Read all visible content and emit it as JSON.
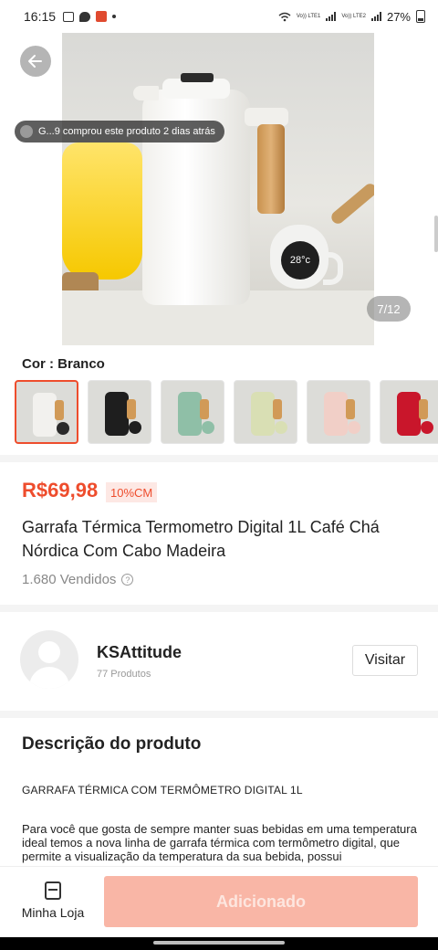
{
  "status_bar": {
    "time": "16:15",
    "network_1": "Vo)) LTE1",
    "network_2": "Vo)) LTE2",
    "battery": "27%"
  },
  "hero": {
    "purchase_notice": "G...9 comprou este produto 2 dias atrás",
    "image_counter": "7/12",
    "cup_display": "28°c"
  },
  "color": {
    "label": "Cor : Branco",
    "options": [
      {
        "name": "branco",
        "body": "#f2f1ee",
        "accent": "#2a2a2a"
      },
      {
        "name": "preto",
        "body": "#1e1e1e",
        "accent": "#1e1e1e"
      },
      {
        "name": "verde",
        "body": "#8fbfa7",
        "accent": "#8fbfa7"
      },
      {
        "name": "creme",
        "body": "#d9dfb4",
        "accent": "#d9dfb4"
      },
      {
        "name": "rosa",
        "body": "#f1cfc7",
        "accent": "#f1cfc7"
      },
      {
        "name": "vermelho",
        "body": "#c9162b",
        "accent": "#c9162b"
      }
    ]
  },
  "product": {
    "price": "R$69,98",
    "discount_tag": "10%CM",
    "title": "Garrafa Térmica Termometro Digital 1L Café Chá Nórdica Com Cabo Madeira",
    "sold": "1.680 Vendidos"
  },
  "store": {
    "name": "KSAttitude",
    "products": "77 Produtos",
    "visit_label": "Visitar"
  },
  "description": {
    "heading": "Descrição do produto",
    "caps_line": "GARRAFA TÉRMICA COM TERMÔMETRO DIGITAL 1L",
    "body": "Para você que gosta de sempre manter suas bebidas em uma temperatura ideal temos a nova linha de garrafa térmica com termômetro digital, que permite a visualização da temperatura da sua bebida, possui"
  },
  "bottom_bar": {
    "my_store_label": "Minha Loja",
    "add_label": "Adicionado"
  },
  "colors": {
    "accent": "#ee4d2d",
    "add_button_bg": "#f9b6a6"
  }
}
